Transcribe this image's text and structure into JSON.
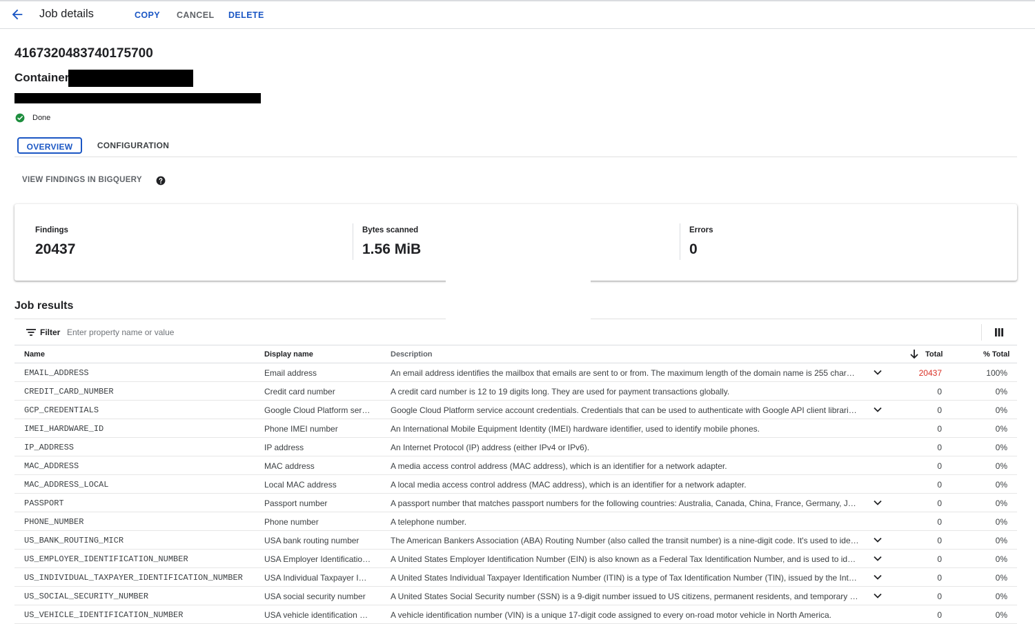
{
  "header": {
    "title": "Job details",
    "copy_label": "COPY",
    "cancel_label": "CANCEL",
    "delete_label": "DELETE",
    "accent_color": "#1a56c4",
    "back_icon": "arrow-back-icon"
  },
  "job": {
    "id": "4167320483740175700",
    "container_label": "Container:",
    "status": "Done",
    "status_color": "#1e8e3e"
  },
  "tabs": [
    {
      "label": "OVERVIEW",
      "active": true
    },
    {
      "label": "CONFIGURATION",
      "active": false
    }
  ],
  "bigquery_link": "VIEW FINDINGS IN BIGQUERY",
  "stats": {
    "findings_label": "Findings",
    "findings_value": "20437",
    "bytes_label": "Bytes scanned",
    "bytes_value": "1.56 MiB",
    "errors_label": "Errors",
    "errors_value": "0"
  },
  "results": {
    "title": "Job results",
    "filter_label": "Filter",
    "filter_placeholder": "Enter property name or value",
    "columns": {
      "name": "Name",
      "display": "Display name",
      "description": "Description",
      "total": "Total",
      "pct": "% Total"
    },
    "highlight_color": "#d93025",
    "rows": [
      {
        "name": "EMAIL_ADDRESS",
        "display": "Email address",
        "description": "An email address identifies the mailbox that emails are sent to or from. The maximum length of the domain name is 255 char…",
        "expandable": true,
        "total": "20437",
        "pct": "100%",
        "highlight": true
      },
      {
        "name": "CREDIT_CARD_NUMBER",
        "display": "Credit card number",
        "description": "A credit card number is 12 to 19 digits long. They are used for payment transactions globally.",
        "expandable": false,
        "total": "0",
        "pct": "0%",
        "highlight": false
      },
      {
        "name": "GCP_CREDENTIALS",
        "display": "Google Cloud Platform ser…",
        "description": "Google Cloud Platform service account credentials. Credentials that can be used to authenticate with Google API client librari…",
        "expandable": true,
        "total": "0",
        "pct": "0%",
        "highlight": false
      },
      {
        "name": "IMEI_HARDWARE_ID",
        "display": "Phone IMEI number",
        "description": "An International Mobile Equipment Identity (IMEI) hardware identifier, used to identify mobile phones.",
        "expandable": false,
        "total": "0",
        "pct": "0%",
        "highlight": false
      },
      {
        "name": "IP_ADDRESS",
        "display": "IP address",
        "description": "An Internet Protocol (IP) address (either IPv4 or IPv6).",
        "expandable": false,
        "total": "0",
        "pct": "0%",
        "highlight": false
      },
      {
        "name": "MAC_ADDRESS",
        "display": "MAC address",
        "description": "A media access control address (MAC address), which is an identifier for a network adapter.",
        "expandable": false,
        "total": "0",
        "pct": "0%",
        "highlight": false
      },
      {
        "name": "MAC_ADDRESS_LOCAL",
        "display": "Local MAC address",
        "description": "A local media access control address (MAC address), which is an identifier for a network adapter.",
        "expandable": false,
        "total": "0",
        "pct": "0%",
        "highlight": false
      },
      {
        "name": "PASSPORT",
        "display": "Passport number",
        "description": "A passport number that matches passport numbers for the following countries: Australia, Canada, China, France, Germany, Ja…",
        "expandable": true,
        "total": "0",
        "pct": "0%",
        "highlight": false
      },
      {
        "name": "PHONE_NUMBER",
        "display": "Phone number",
        "description": "A telephone number.",
        "expandable": false,
        "total": "0",
        "pct": "0%",
        "highlight": false
      },
      {
        "name": "US_BANK_ROUTING_MICR",
        "display": "USA bank routing number",
        "description": "The American Bankers Association (ABA) Routing Number (also called the transit number) is a nine-digit code. It's used to ide…",
        "expandable": true,
        "total": "0",
        "pct": "0%",
        "highlight": false
      },
      {
        "name": "US_EMPLOYER_IDENTIFICATION_NUMBER",
        "display": "USA Employer Identificatio…",
        "description": "A United States Employer Identification Number (EIN) is also known as a Federal Tax Identification Number, and is used to ide…",
        "expandable": true,
        "total": "0",
        "pct": "0%",
        "highlight": false
      },
      {
        "name": "US_INDIVIDUAL_TAXPAYER_IDENTIFICATION_NUMBER",
        "display": "USA Individual Taxpayer Id…",
        "description": "A United States Individual Taxpayer Identification Number (ITIN) is a type of Tax Identification Number (TIN), issued by the Int…",
        "expandable": true,
        "total": "0",
        "pct": "0%",
        "highlight": false
      },
      {
        "name": "US_SOCIAL_SECURITY_NUMBER",
        "display": "USA social security number",
        "description": "A United States Social Security number (SSN) is a 9-digit number issued to US citizens, permanent residents, and temporary r…",
        "expandable": true,
        "total": "0",
        "pct": "0%",
        "highlight": false
      },
      {
        "name": "US_VEHICLE_IDENTIFICATION_NUMBER",
        "display": "USA vehicle identification …",
        "description": "A vehicle identification number (VIN) is a unique 17-digit code assigned to every on-road motor vehicle in North America.",
        "expandable": false,
        "total": "0",
        "pct": "0%",
        "highlight": false
      }
    ]
  }
}
